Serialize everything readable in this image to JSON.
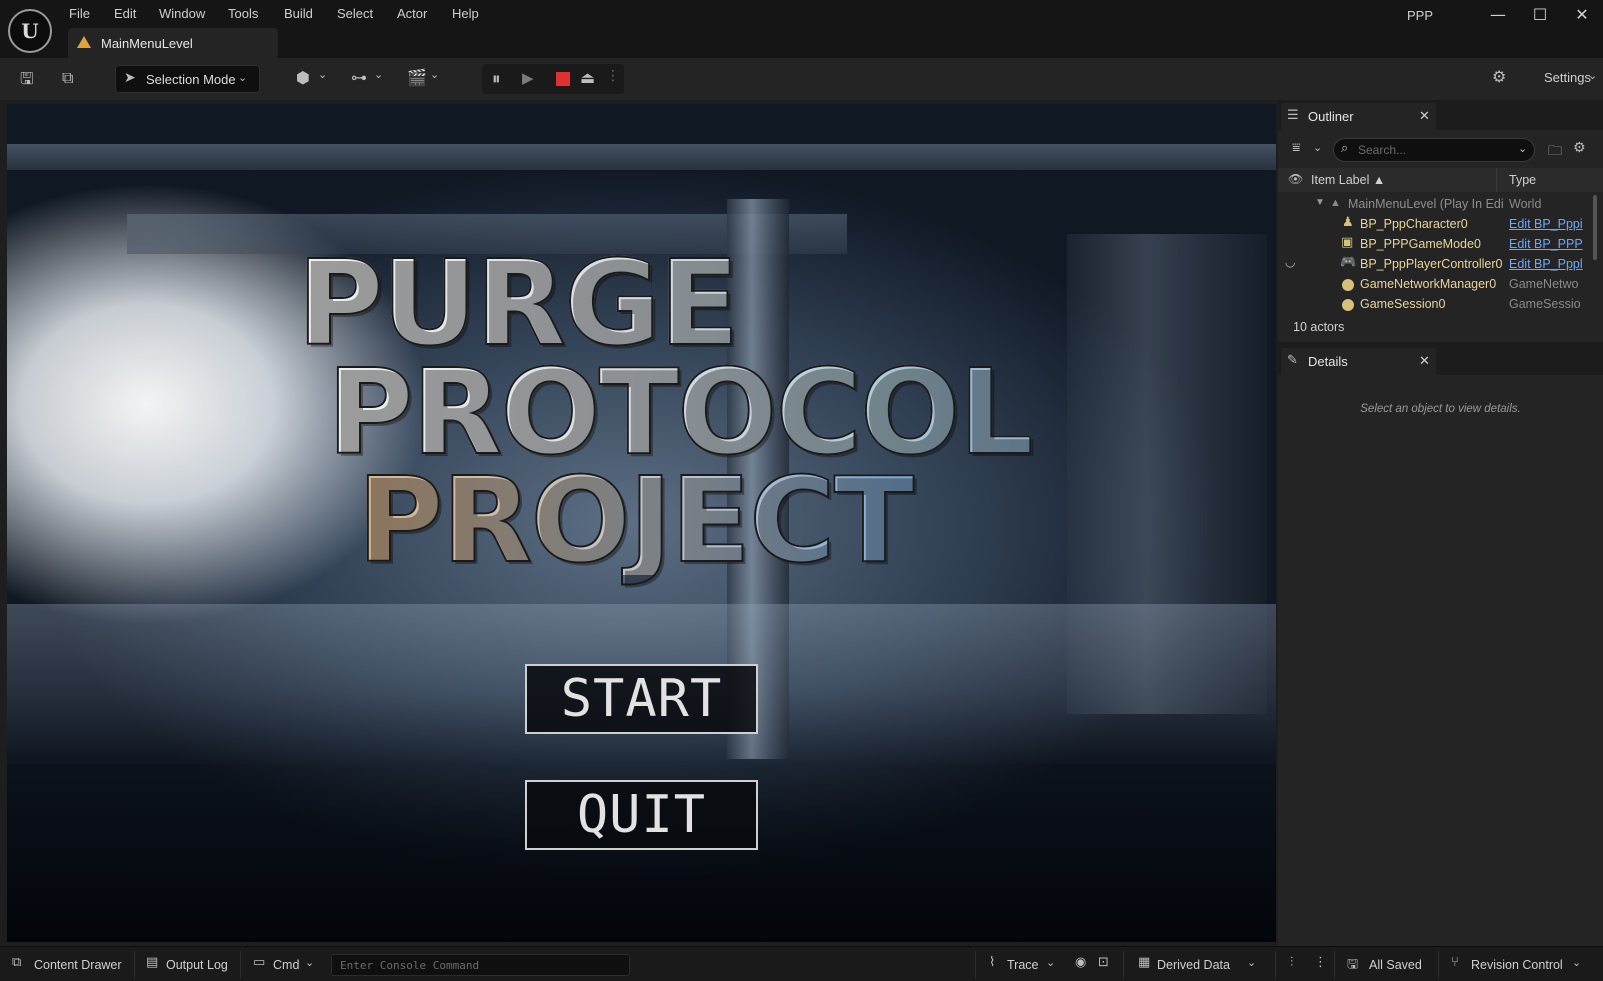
{
  "titlebar": {
    "menu": [
      "File",
      "Edit",
      "Window",
      "Tools",
      "Build",
      "Select",
      "Actor",
      "Help"
    ],
    "level_tab": "MainMenuLevel",
    "project": "PPP",
    "minimize": "—",
    "maximize": "☐",
    "close": "✕"
  },
  "toolbar": {
    "selection_mode": "Selection Mode",
    "settings": "Settings"
  },
  "game": {
    "logo_lines": [
      "PURGE",
      "PROTOCOL",
      "PROJECT"
    ],
    "start": "START",
    "quit": "QUIT"
  },
  "outliner": {
    "tab": "Outliner",
    "search_placeholder": "Search...",
    "col_label": "Item Label ▲",
    "col_type": "Type",
    "world_row": {
      "label": "MainMenuLevel (Play In Edi",
      "type": "World"
    },
    "rows": [
      {
        "label": "BP_PppCharacter0",
        "type": "Edit BP_Pppi",
        "link": true,
        "icon": "pawn-icon"
      },
      {
        "label": "BP_PPPGameMode0",
        "type": "Edit BP_PPP",
        "link": true,
        "icon": "gamemode-icon"
      },
      {
        "label": "BP_PppPlayerController0",
        "type": "Edit BP_Pppl",
        "link": true,
        "icon": "gamepad-icon"
      },
      {
        "label": "GameNetworkManager0",
        "type": "GameNetwo",
        "link": false,
        "icon": "actor-icon"
      },
      {
        "label": "GameSession0",
        "type": "GameSessio",
        "link": false,
        "icon": "actor-icon"
      }
    ],
    "actors_count": "10 actors"
  },
  "details": {
    "tab": "Details",
    "empty": "Select an object to view details."
  },
  "statusbar": {
    "content_drawer": "Content Drawer",
    "output_log": "Output Log",
    "cmd": "Cmd",
    "console_placeholder": "Enter Console Command",
    "trace": "Trace",
    "derived_data": "Derived Data",
    "all_saved": "All Saved",
    "revision_control": "Revision Control"
  },
  "colors": {
    "accent": "#e0302f",
    "link": "#6aa8ff",
    "actor_label": "#e9d49a",
    "level_icon": "#e2a23a"
  }
}
